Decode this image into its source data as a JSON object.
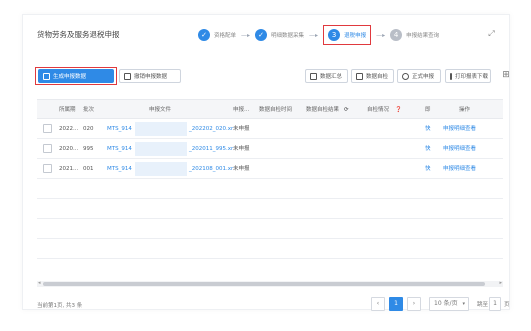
{
  "header": {
    "title": "货物劳务及服务退税申报",
    "steps": [
      {
        "label": "资格配单",
        "state": "done"
      },
      {
        "label": "明细数据采集",
        "state": "done"
      },
      {
        "label": "退税申报",
        "state": "active",
        "num": "3"
      },
      {
        "label": "申报结果查询",
        "state": "todo",
        "num": "4"
      }
    ],
    "arrow": "—▸"
  },
  "toolbar": {
    "generate": "生成申报数据",
    "delete": "撤销申报数据",
    "summary": "数据汇总",
    "selfcheck": "数据自检",
    "formal": "正式申报",
    "print": "打印报表下载"
  },
  "table": {
    "headers": {
      "period": "所属期",
      "batch": "批次",
      "file": "申报文件",
      "status": "申报...",
      "checktime": "数据自检时间",
      "checkresult": "数据自检结果",
      "selfstatus": "自检情况",
      "col_extra": "即",
      "ops": "操作"
    },
    "rows": [
      {
        "period": "2022...",
        "batch": "020",
        "file_prefix": "MTS_914",
        "file_suffix": "_202202_020.xr",
        "status": "未申报",
        "extra": "快",
        "op": "申报明细查看"
      },
      {
        "period": "2020...",
        "batch": "995",
        "file_prefix": "MTS_914",
        "file_suffix": "_202011_995.xr",
        "status": "未申报",
        "extra": "快",
        "op": "申报明细查看"
      },
      {
        "period": "2021...",
        "batch": "001",
        "file_prefix": "MTS_914",
        "file_suffix": "_202108_001.xr",
        "status": "未申报",
        "extra": "快",
        "op": "申报明细查看"
      }
    ]
  },
  "footer": {
    "count": "当前第1页, 共3 条",
    "page": "1",
    "page_size": "10 条/页",
    "goto": "跳至",
    "goto_value": "1",
    "page_unit": "页"
  },
  "colors": {
    "accent": "#2f8ae6",
    "highlight": "#e0393e"
  }
}
